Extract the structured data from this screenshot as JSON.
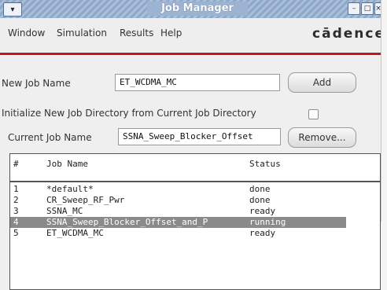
{
  "window": {
    "title": "Job Manager",
    "menu_glyph": "▾",
    "controls": {
      "minimize": "–",
      "maximize": "□",
      "close": "×"
    }
  },
  "menubar": {
    "items": [
      "Window",
      "Simulation",
      "Results",
      "Help"
    ],
    "logo": "cādence"
  },
  "form": {
    "new_job_label": "New Job Name",
    "new_job_value": "ET_WCDMA_MC",
    "add_button": "Add",
    "init_label": "Initialize New Job Directory from Current Job Directory",
    "init_checked": false,
    "current_job_label": "Current Job Name",
    "current_job_value": "SSNA_Sweep_Blocker_Offset",
    "remove_button": "Remove..."
  },
  "table": {
    "headers": [
      "#",
      "Job Name",
      "Status"
    ],
    "rows": [
      {
        "num": "1",
        "name": "*default*",
        "status": "done",
        "selected": false
      },
      {
        "num": "2",
        "name": "CR_Sweep_RF_Pwr",
        "status": "done",
        "selected": false
      },
      {
        "num": "3",
        "name": "SSNA_MC",
        "status": "ready",
        "selected": false
      },
      {
        "num": "4",
        "name": "SSNA_Sweep_Blocker_Offset_and_P",
        "status": "running",
        "selected": true
      },
      {
        "num": "5",
        "name": "ET_WCDMA_MC",
        "status": "ready",
        "selected": false
      }
    ]
  },
  "colors": {
    "accent_red": "#c8151b",
    "titlebar": "#9db3d2",
    "selected_row": "#8a8a8a"
  }
}
